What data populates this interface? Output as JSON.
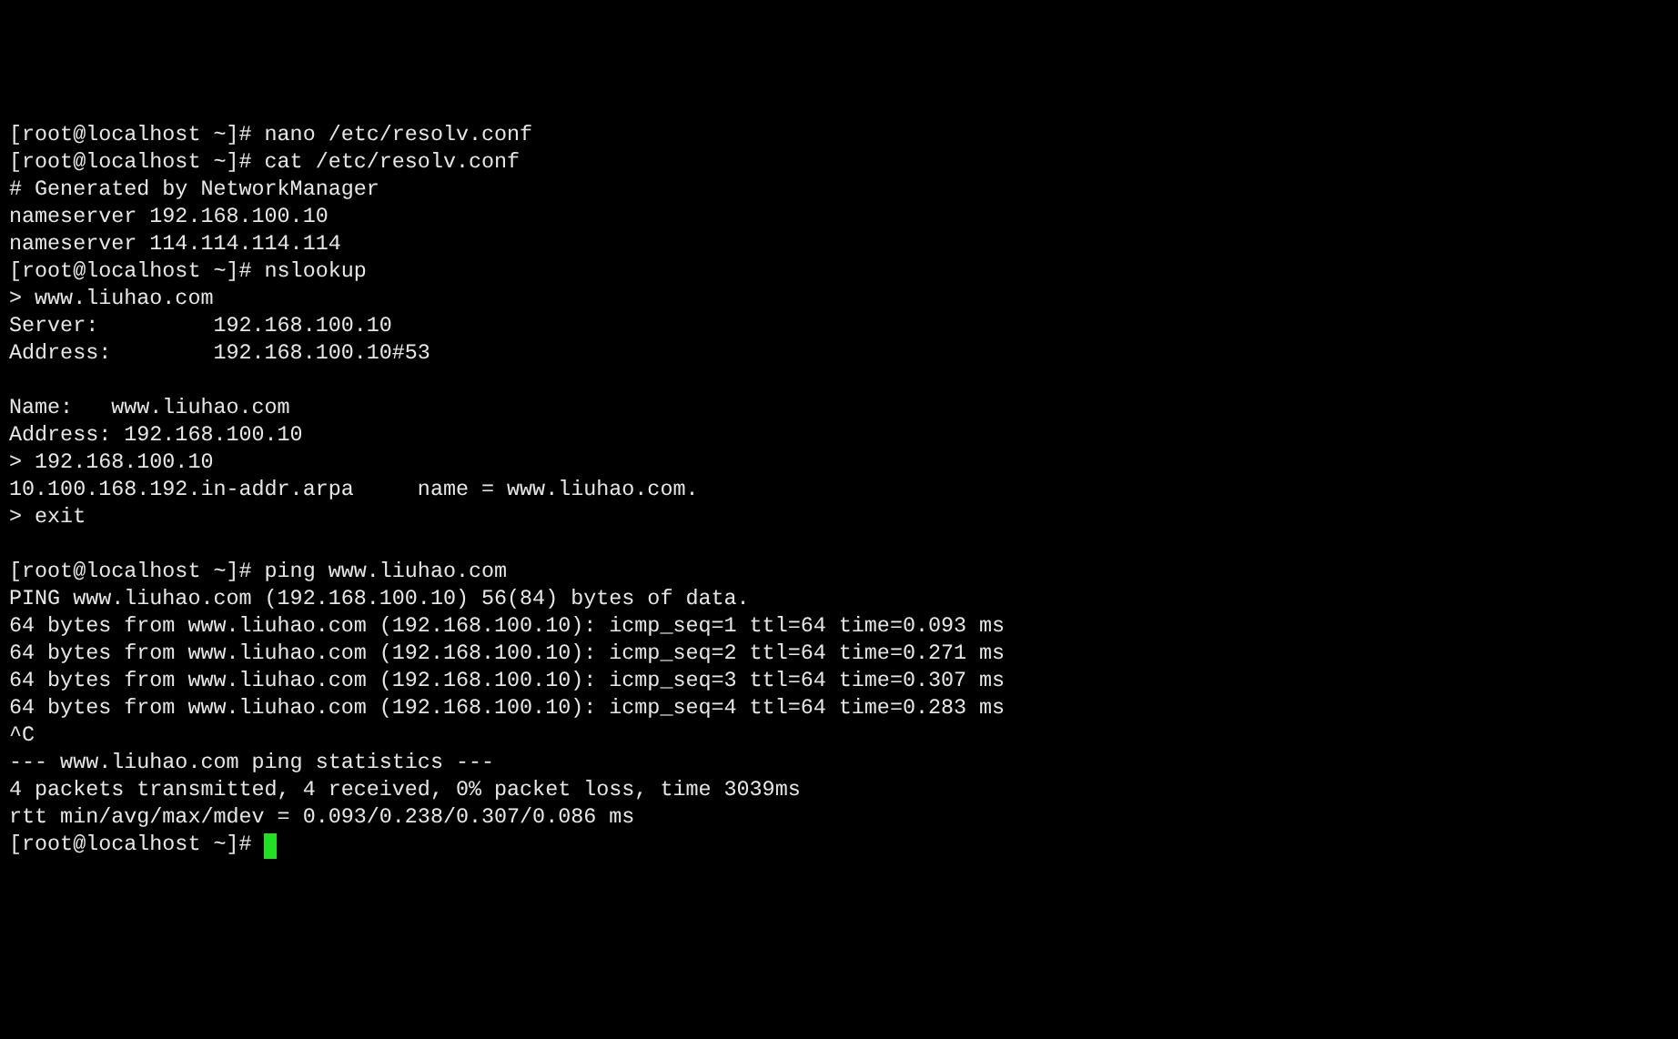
{
  "terminal": {
    "lines": [
      {
        "kind": "text",
        "text": "[root@localhost ~]# nano /etc/resolv.conf"
      },
      {
        "kind": "text",
        "text": "[root@localhost ~]# cat /etc/resolv.conf"
      },
      {
        "kind": "text",
        "text": "# Generated by NetworkManager"
      },
      {
        "kind": "text",
        "text": "nameserver 192.168.100.10"
      },
      {
        "kind": "text",
        "text": "nameserver 114.114.114.114"
      },
      {
        "kind": "text",
        "text": "[root@localhost ~]# nslookup"
      },
      {
        "kind": "text",
        "text": "> www.liuhao.com"
      },
      {
        "kind": "text",
        "text": "Server:         192.168.100.10"
      },
      {
        "kind": "text",
        "text": "Address:        192.168.100.10#53"
      },
      {
        "kind": "blank"
      },
      {
        "kind": "text",
        "text": "Name:   www.liuhao.com"
      },
      {
        "kind": "text",
        "text": "Address: 192.168.100.10"
      },
      {
        "kind": "text",
        "text": "> 192.168.100.10"
      },
      {
        "kind": "text",
        "text": "10.100.168.192.in-addr.arpa     name = www.liuhao.com."
      },
      {
        "kind": "text",
        "text": "> exit"
      },
      {
        "kind": "blank"
      },
      {
        "kind": "text",
        "text": "[root@localhost ~]# ping www.liuhao.com"
      },
      {
        "kind": "text",
        "text": "PING www.liuhao.com (192.168.100.10) 56(84) bytes of data."
      },
      {
        "kind": "text",
        "text": "64 bytes from www.liuhao.com (192.168.100.10): icmp_seq=1 ttl=64 time=0.093 ms"
      },
      {
        "kind": "text",
        "text": "64 bytes from www.liuhao.com (192.168.100.10): icmp_seq=2 ttl=64 time=0.271 ms"
      },
      {
        "kind": "text",
        "text": "64 bytes from www.liuhao.com (192.168.100.10): icmp_seq=3 ttl=64 time=0.307 ms"
      },
      {
        "kind": "text",
        "text": "64 bytes from www.liuhao.com (192.168.100.10): icmp_seq=4 ttl=64 time=0.283 ms"
      },
      {
        "kind": "text",
        "text": "^C"
      },
      {
        "kind": "text",
        "text": "--- www.liuhao.com ping statistics ---"
      },
      {
        "kind": "text",
        "text": "4 packets transmitted, 4 received, 0% packet loss, time 3039ms"
      },
      {
        "kind": "text",
        "text": "rtt min/avg/max/mdev = 0.093/0.238/0.307/0.086 ms"
      },
      {
        "kind": "prompt",
        "text": "[root@localhost ~]#"
      }
    ]
  }
}
